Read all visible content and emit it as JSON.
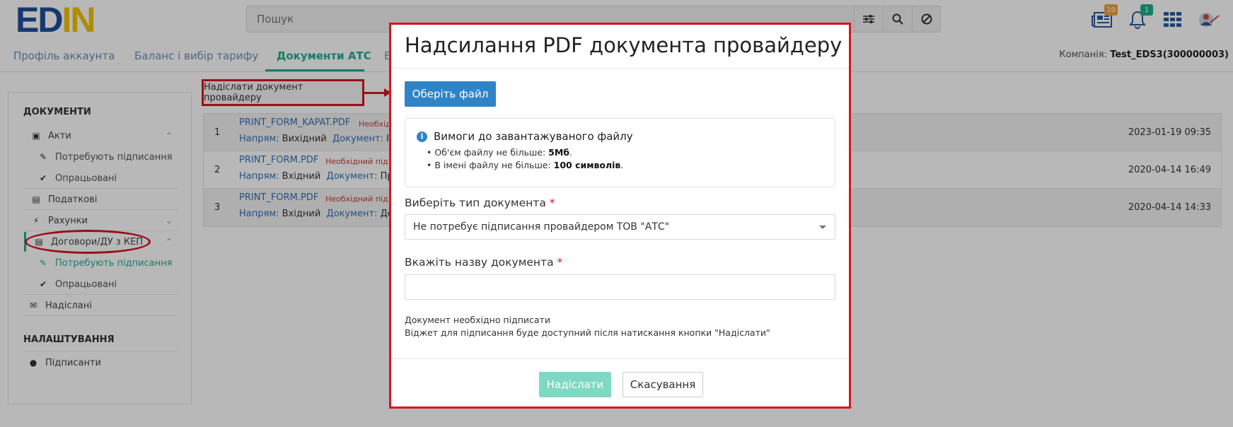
{
  "header": {
    "logo_part1": "ED",
    "logo_part2": "N",
    "search_placeholder": "Пошук",
    "notifications_badge": "10",
    "bell_badge": "1"
  },
  "tabs": [
    {
      "label": "Профіль аккаунта"
    },
    {
      "label": "Баланс і вибір тарифу"
    },
    {
      "label": "Документи АТС"
    },
    {
      "label": "Е"
    }
  ],
  "company": {
    "label": "Компанія:",
    "value": "Test_EDS3(300000003)"
  },
  "sidebar": {
    "documents_header": "ДОКУМЕНТИ",
    "items": [
      {
        "label": "Акти",
        "icon": "stamp-icon"
      },
      {
        "label": "Потребують підписання",
        "icon": "pen-icon"
      },
      {
        "label": "Опрацьовані",
        "icon": "check-circle-icon"
      },
      {
        "label": "Податкові",
        "icon": "tax-icon"
      },
      {
        "label": "Рахунки",
        "icon": "bolt-icon"
      },
      {
        "label": "Договори/ДУ з КЕП",
        "icon": "document-icon"
      },
      {
        "label": "Потребують підписання",
        "icon": "pen-icon"
      },
      {
        "label": "Опрацьовані",
        "icon": "check-circle-icon"
      },
      {
        "label": "Надіслані",
        "icon": "envelope-icon"
      }
    ],
    "settings_header": "НАЛАШТУВАННЯ",
    "signers": {
      "label": "Підписанти",
      "icon": "user-icon"
    }
  },
  "main": {
    "send_button_label": "Надіслати документ провайдеру",
    "rows": [
      {
        "num": "1",
        "file": "PRINT_FORM_KAPAT.PDF",
        "req": "Необхід",
        "dir_label": "Напрям:",
        "dir": "Вихідний",
        "doc_label": "Документ:",
        "doc": "Ін",
        "date": "2023-01-19 09:35"
      },
      {
        "num": "2",
        "file": "PRINT_FORM.PDF",
        "req": "Необхідний під",
        "dir_label": "Напрям:",
        "dir": "Вхідний",
        "doc_label": "Документ:",
        "doc": "Про",
        "date": "2020-04-14 16:49"
      },
      {
        "num": "3",
        "file": "PRINT_FORM.PDF",
        "req": "Необхідний під",
        "dir_label": "Напрям:",
        "dir": "Вхідний",
        "doc_label": "Документ:",
        "doc": "До",
        "date": "2020-04-14 14:33"
      }
    ]
  },
  "modal": {
    "title": "Надсилання PDF документа провайдеру",
    "choose_file": "Оберіть файл",
    "requirements_title": "Вимоги до завантажуваного файлу",
    "req1_text": "Об'єм файлу не більше: ",
    "req1_bold": "5Мб",
    "req1_end": ".",
    "req2_text": "В імені файлу не більше: ",
    "req2_bold": "100 символів",
    "req2_end": ".",
    "doc_type_label": "Виберіть тип документа",
    "doc_type_value": "Не потребує підписання провайдером ТОВ \"АТС\"",
    "doc_name_label": "Вкажіть назву документа",
    "doc_name_value": "",
    "note1": "Документ необхідно підписати",
    "note2": "Віджет для підписання буде доступний після натискання кнопки \"Надіслати\"",
    "send": "Надіслати",
    "cancel": "Скасування",
    "required_mark": "*"
  }
}
